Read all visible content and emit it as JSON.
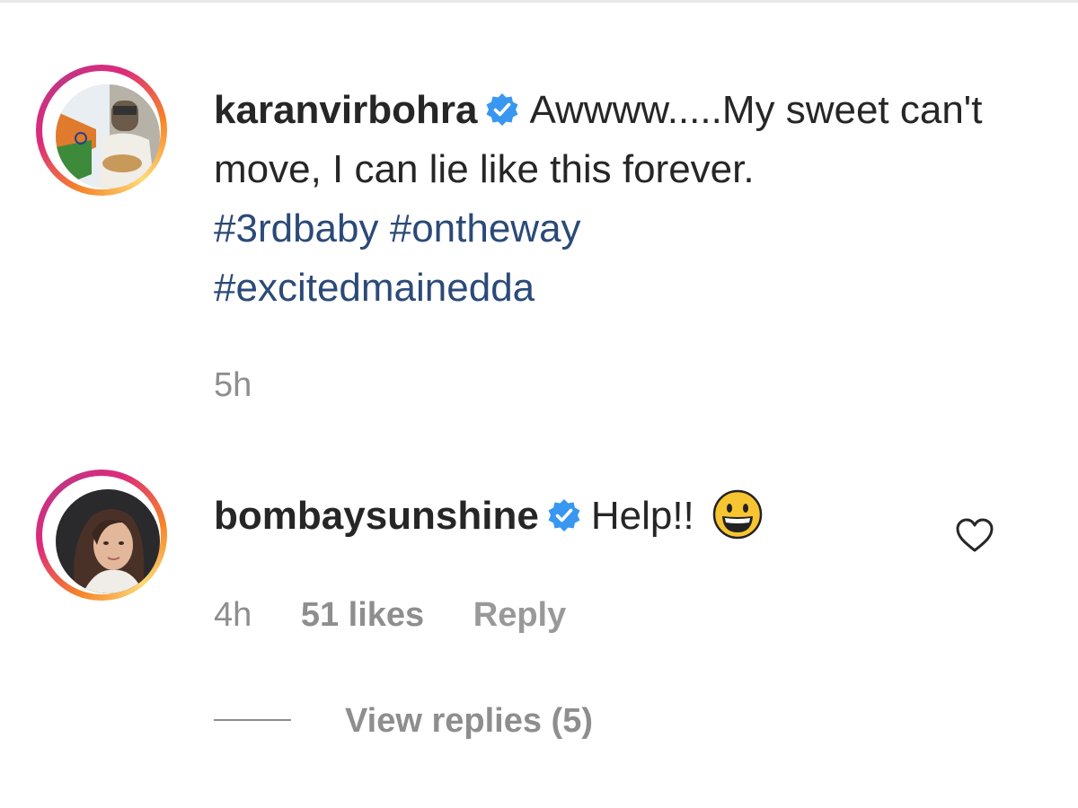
{
  "comments": [
    {
      "username": "karanvirbohra",
      "verified": true,
      "text": "Awwww.....My sweet can't move, I can lie like this forever.",
      "hashtags": [
        "#3rdbaby",
        "#ontheway",
        "#excitedmainedda"
      ],
      "time": "5h"
    },
    {
      "username": "bombaysunshine",
      "verified": true,
      "text": "Help!!",
      "emoji": "grinning-face",
      "time": "4h",
      "likes": "51 likes",
      "reply_label": "Reply",
      "view_replies": "View replies (5)"
    }
  ],
  "colors": {
    "hashtag": "#2b4a78",
    "verified_badge": "#3897f0",
    "meta_text": "#8e8e8e",
    "main_text": "#262626"
  }
}
